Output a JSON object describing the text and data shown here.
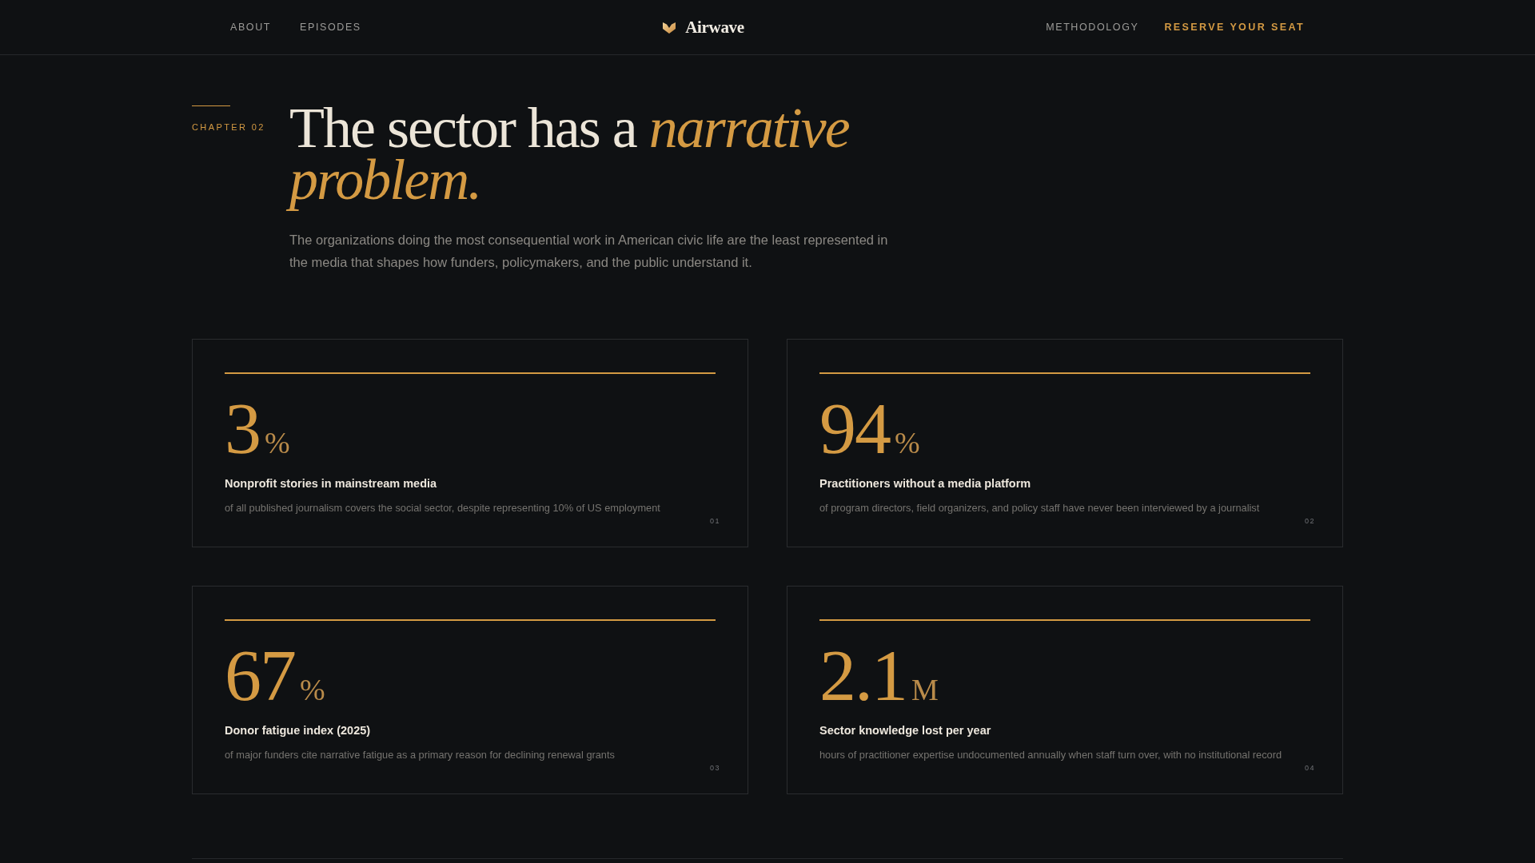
{
  "nav": {
    "left_links": [
      {
        "label": "ABOUT",
        "kind": "link"
      },
      {
        "label": "EPISODES",
        "kind": "link"
      }
    ],
    "brand": "Airwave",
    "right_links": [
      {
        "label": "METHODOLOGY",
        "kind": "link"
      },
      {
        "label": "RESERVE YOUR SEAT",
        "kind": "cta"
      }
    ]
  },
  "chapter": {
    "label": "CHAPTER 02",
    "heading": "The sector has a *narrative problem.*",
    "intro": "The organizations doing the most consequential work in American civic life are the least represented in the media that shapes how funders, policymakers, and the public understand it."
  },
  "stats": [
    {
      "value": "3",
      "unit": "%",
      "title": "Nonprofit stories in mainstream media",
      "description": "of all published journalism covers the social sector, despite representing 10% of US employment",
      "index": "01"
    },
    {
      "value": "94",
      "unit": "%",
      "title": "Practitioners without a media platform",
      "description": "of program directors, field organizers, and policy staff have never been interviewed by a journalist",
      "index": "02"
    },
    {
      "value": "67",
      "unit": "%",
      "title": "Donor fatigue index (2025)",
      "description": "of major funders cite narrative fatigue as a primary reason for declining renewal grants",
      "index": "03"
    },
    {
      "value": "2.1",
      "unit": "M",
      "title": "Sector knowledge lost per year",
      "description": "hours of practitioner expertise undocumented annually when staff turn over, with no institutional record",
      "index": "04"
    }
  ]
}
